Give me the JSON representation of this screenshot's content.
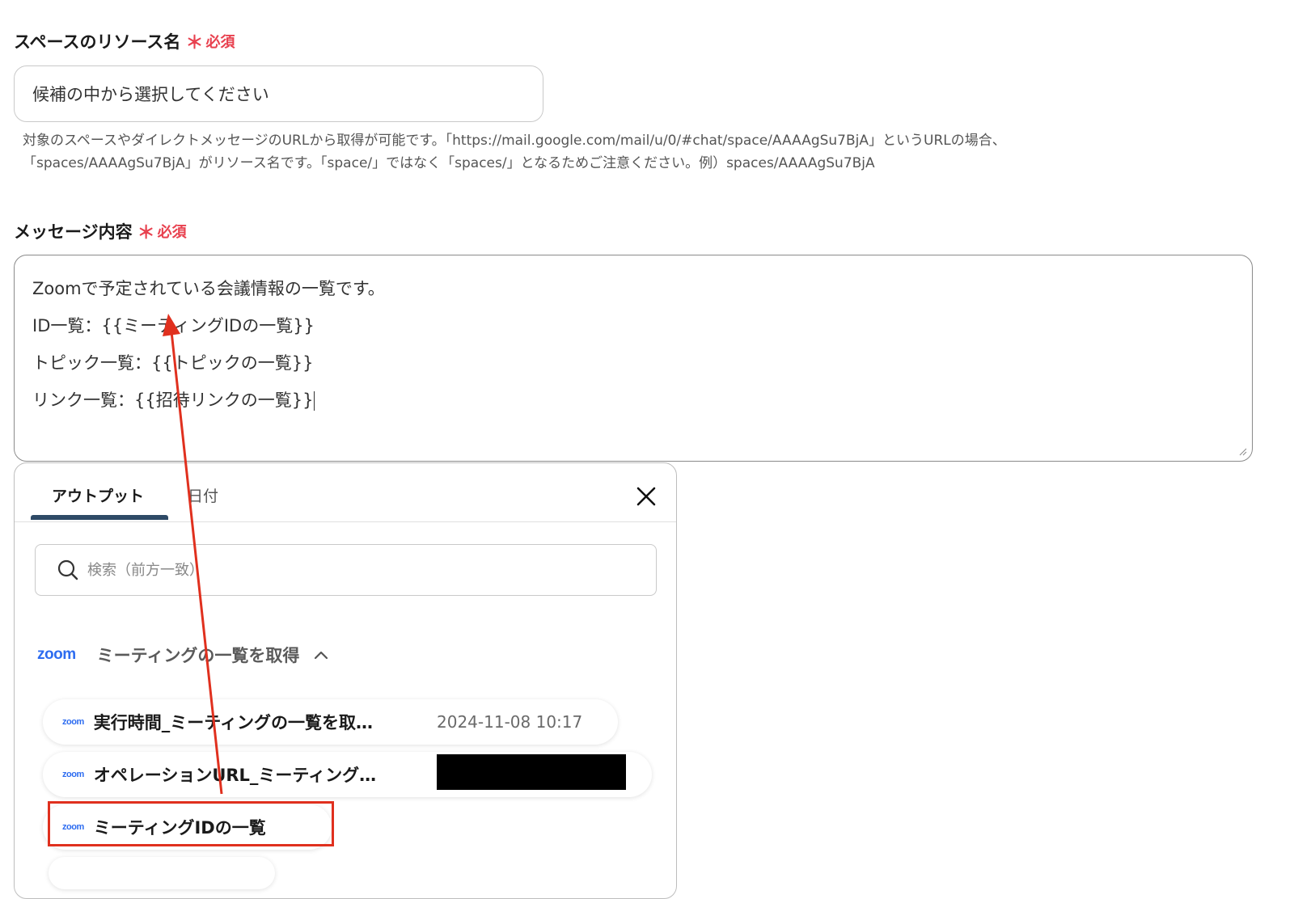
{
  "space_field": {
    "label": "スペースのリソース名",
    "required_mark": "＊",
    "required_text": "必須",
    "placeholder": "候補の中から選択してください",
    "help_line1": "対象のスペースやダイレクトメッセージのURLから取得が可能です。「https://mail.google.com/mail/u/0/#chat/space/AAAAgSu7BjA」というURLの場合、",
    "help_line2": "「spaces/AAAAgSu7BjA」がリソース名です。「space/」ではなく「spaces/」となるためご注意ください。例）spaces/AAAAgSu7BjA"
  },
  "message_field": {
    "label": "メッセージ内容",
    "required_mark": "＊",
    "required_text": "必須",
    "lines": [
      "Zoomで予定されている会議情報の一覧です。",
      "ID一覧：{{ミーティングIDの一覧}}",
      "トピック一覧：{{トピックの一覧}}",
      "リンク一覧：{{招待リンクの一覧}}"
    ]
  },
  "output_panel": {
    "tabs": [
      "アウトプット",
      "日付"
    ],
    "active_tab": "アウトプット",
    "search_placeholder": "検索（前方一致）",
    "group": {
      "logo_text": "zoom",
      "title": "ミーティングの一覧を取得",
      "expanded": true
    },
    "items": [
      {
        "logo_text": "zoom",
        "label": "実行時間_ミーティングの一覧を取…",
        "value": "2024-11-08 10:17"
      },
      {
        "logo_text": "zoom",
        "label": "オペレーションURL_ミーティング…",
        "value": ""
      },
      {
        "logo_text": "zoom",
        "label": "ミーティングIDの一覧",
        "value": ""
      }
    ]
  },
  "colors": {
    "required": "#e8414f",
    "annotation_red": "#e0301e",
    "tab_underline": "#2e4a66",
    "zoom_blue": "#2d6cf0"
  }
}
